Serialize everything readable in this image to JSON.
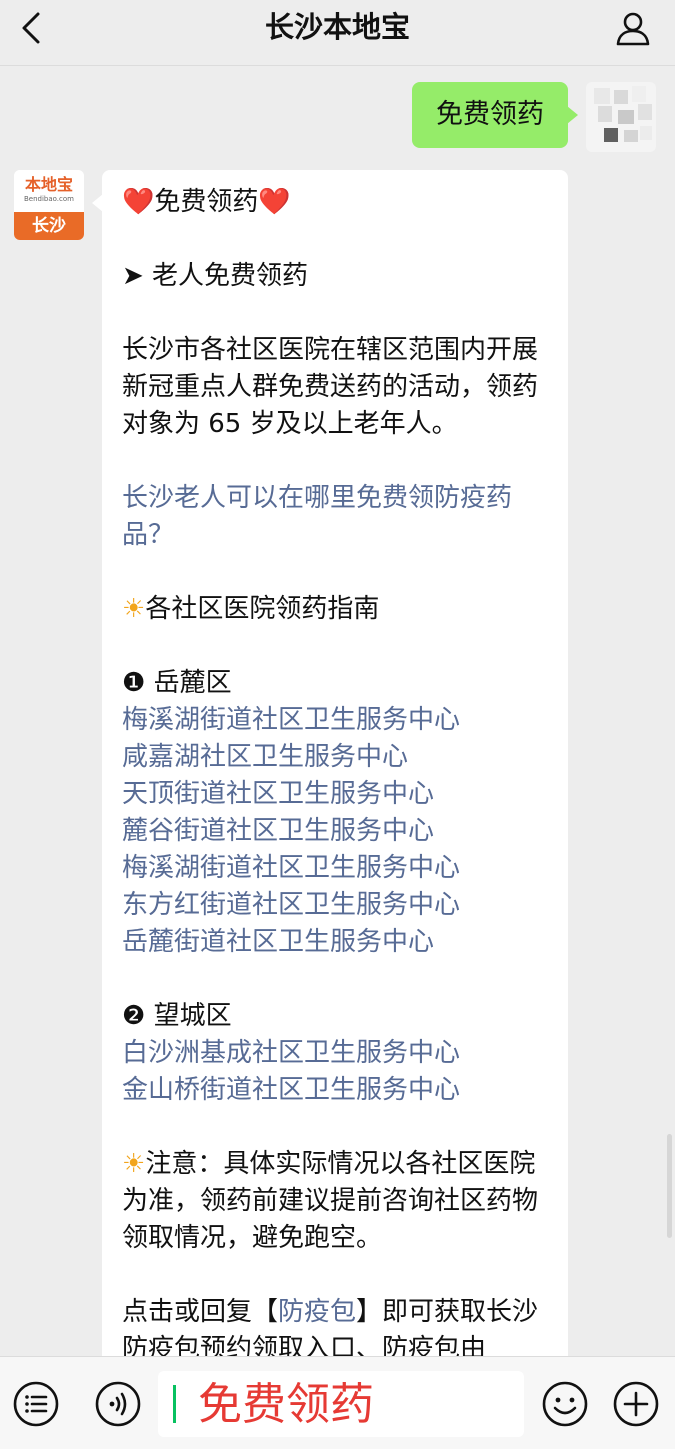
{
  "header": {
    "title": "长沙本地宝",
    "back_icon": "chevron-left-icon",
    "profile_icon": "person-icon"
  },
  "outgoing_message": {
    "text": "免费领药"
  },
  "account_logo": {
    "name": "本地宝",
    "domain": "Bendibao.com",
    "city": "长沙"
  },
  "message": {
    "heading_icon": "❤️",
    "heading": "免费领药",
    "section1": "➤ 老人免费领药",
    "para1": "长沙市各社区医院在辖区范围内开展新冠重点人群免费送药的活动，领药对象为 65 岁及以上老年人。",
    "link1": "长沙老人可以在哪里免费领防疫药品？",
    "sun_icon": "☀",
    "guide": "各社区医院领药指南",
    "district1": "❶ 岳麓区",
    "district1_centers": [
      "梅溪湖街道社区卫生服务中心",
      "咸嘉湖社区卫生服务中心",
      "天顶街道社区卫生服务中心",
      "麓谷街道社区卫生服务中心",
      "梅溪湖街道社区卫生服务中心",
      "东方红街道社区卫生服务中心",
      "岳麓街道社区卫生服务中心"
    ],
    "district2": "❷ 望城区",
    "district2_centers": [
      "白沙洲基成社区卫生服务中心",
      "金山桥街道社区卫生服务中心"
    ],
    "note": "注意：具体实际情况以各社区医院为准，领药前建议提前咨询社区药物领取情况，避免跑空。",
    "reply_prefix": "点击或回复【",
    "reply_keyword": "防疫包",
    "reply_suffix": "】即可获取长沙防疫包预约领取入口、防疫包由"
  },
  "input_bar": {
    "menu_icon": "menu-list-icon",
    "voice_icon": "voice-icon",
    "input_text": "免费领药",
    "emoji_icon": "emoji-icon",
    "add_icon": "plus-icon"
  }
}
